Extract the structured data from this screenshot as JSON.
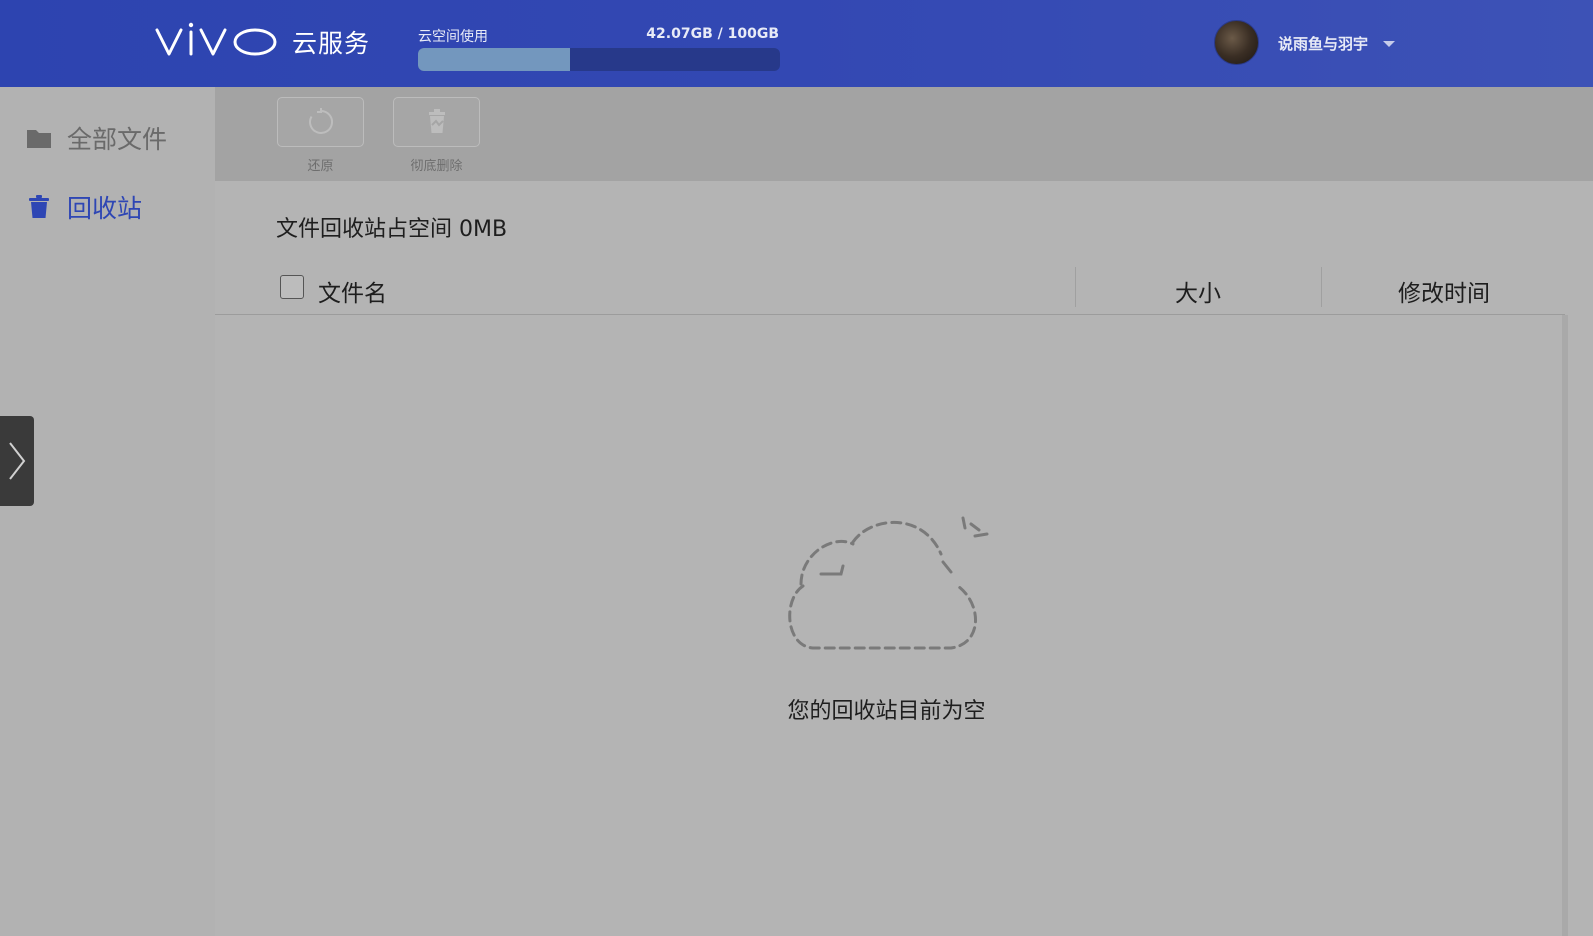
{
  "header": {
    "brand": "vivo",
    "service_name": "云服务",
    "storage": {
      "label": "云空间使用",
      "used_text": "42.07GB / 100GB",
      "used_fraction": 0.4207
    },
    "user": {
      "name": "说雨鱼与羽宇"
    }
  },
  "sidebar": {
    "items": [
      {
        "label": "全部文件",
        "icon": "folder-icon",
        "active": false
      },
      {
        "label": "回收站",
        "icon": "trash-icon",
        "active": true
      }
    ]
  },
  "toolbar": {
    "restore_label": "还原",
    "delete_label": "彻底删除"
  },
  "main": {
    "usage_text": "文件回收站占空间 0MB",
    "columns": {
      "name": "文件名",
      "size": "大小",
      "modified": "修改时间"
    },
    "empty_message": "您的回收站目前为空"
  },
  "colors": {
    "header_bg": "#2d44b0",
    "accent": "#2e46b4",
    "storage_fill": "#7397be",
    "overlay_gray": "#b4b4b4"
  }
}
